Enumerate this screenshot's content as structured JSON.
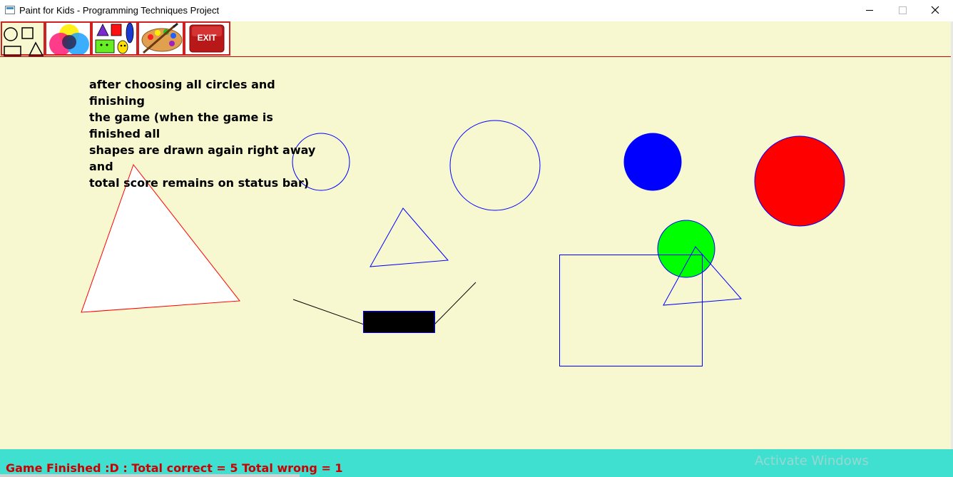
{
  "window": {
    "title": "Paint for Kids - Programming Techniques Project",
    "icons": {
      "app": "paint-app-icon",
      "minimize": "minimize-icon",
      "maximize": "maximize-icon",
      "close": "close-icon"
    }
  },
  "toolbar": {
    "items": [
      {
        "name": "draw-shapes",
        "icon": "shapes-icon"
      },
      {
        "name": "colors",
        "icon": "color-wheel-icon"
      },
      {
        "name": "pick-and-hide",
        "icon": "colored-shapes-icon"
      },
      {
        "name": "play-mode",
        "icon": "paint-palette-icon"
      },
      {
        "name": "exit",
        "icon": "exit-icon",
        "label": "EXIT"
      }
    ],
    "border_color": "#cc2222"
  },
  "canvas": {
    "background": "#f8f8d0",
    "caption": [
      "after choosing all circles and finishing",
      "the game (when the game is finished all",
      "shapes are drawn again right away and",
      "total score remains on status bar)"
    ],
    "shapes": [
      {
        "type": "triangle",
        "stroke": "#ff0000",
        "fill": "#ffffff"
      },
      {
        "type": "circle",
        "stroke": "#0000ff",
        "fill": "none"
      },
      {
        "type": "circle",
        "stroke": "#0000ff",
        "fill": "none"
      },
      {
        "type": "circle",
        "stroke": "#0000ff",
        "fill": "#0000ff"
      },
      {
        "type": "circle",
        "stroke": "#0000ff",
        "fill": "#ff0000"
      },
      {
        "type": "triangle",
        "stroke": "#0000ff",
        "fill": "none"
      },
      {
        "type": "circle",
        "stroke": "#0000ff",
        "fill": "#00ff00"
      },
      {
        "type": "rectangle",
        "stroke": "#0000ff",
        "fill": "none"
      },
      {
        "type": "triangle",
        "stroke": "#0000ff",
        "fill": "none"
      },
      {
        "type": "line",
        "stroke": "#000000"
      },
      {
        "type": "line",
        "stroke": "#000000"
      },
      {
        "type": "rectangle",
        "stroke": "#0000ff",
        "fill": "#000000"
      }
    ]
  },
  "status": {
    "text": "Game Finished :D : Total correct = 5 Total wrong = 1",
    "background": "#40e0d0",
    "color": "#cc0000"
  },
  "watermark": "Activate Windows"
}
